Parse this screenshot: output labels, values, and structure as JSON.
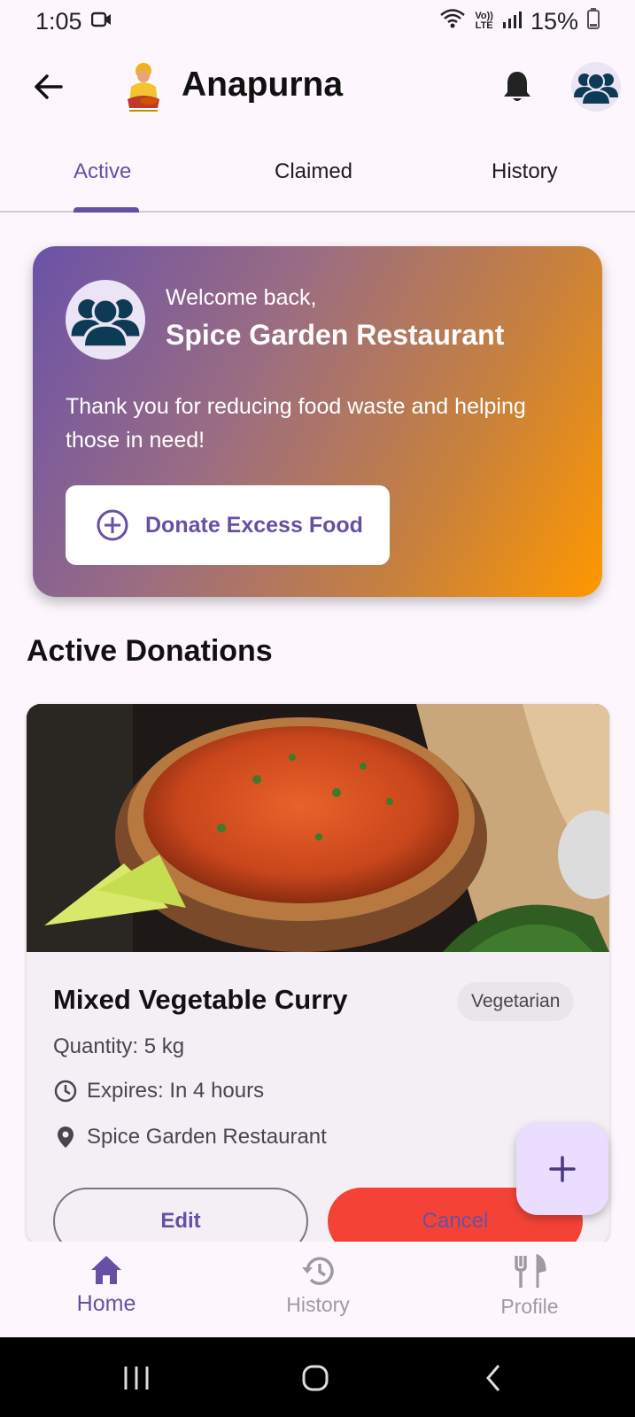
{
  "status_bar": {
    "time": "1:05",
    "network_top": "Vo))",
    "network_bottom": "LTE",
    "battery": "15%"
  },
  "app_bar": {
    "title": "Anapurna"
  },
  "tabs": [
    {
      "label": "Active",
      "active": true
    },
    {
      "label": "Claimed",
      "active": false
    },
    {
      "label": "History",
      "active": false
    }
  ],
  "welcome": {
    "greeting": "Welcome back,",
    "name": "Spice Garden Restaurant",
    "message": "Thank you for reducing food waste and helping those in need!",
    "donate_button": "Donate Excess Food"
  },
  "section_title": "Active Donations",
  "donation": {
    "name": "Mixed Vegetable Curry",
    "tag": "Vegetarian",
    "quantity": "Quantity: 5 kg",
    "expires": "Expires: In 4 hours",
    "location": "Spice Garden Restaurant",
    "edit_button": "Edit",
    "cancel_button": "Cancel"
  },
  "bottom_nav": [
    {
      "label": "Home",
      "icon": "home-icon",
      "active": true
    },
    {
      "label": "History",
      "icon": "history-icon",
      "active": false
    },
    {
      "label": "Profile",
      "icon": "restaurant-icon",
      "active": false
    }
  ],
  "colors": {
    "primary": "#6750a4",
    "accent_orange": "#ff9800",
    "cancel_red": "#f44336"
  }
}
